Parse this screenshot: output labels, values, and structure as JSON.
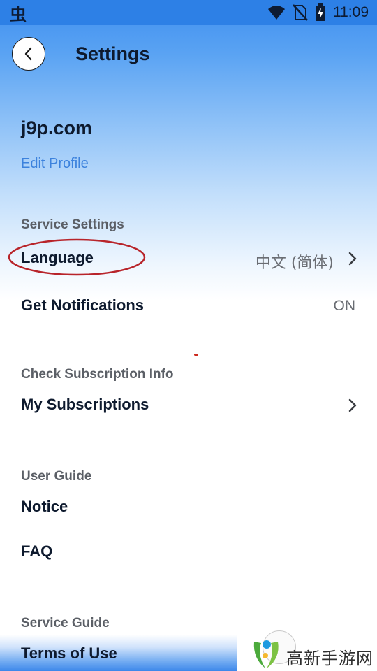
{
  "status_bar": {
    "left_glyph": "虫",
    "time": "11:09",
    "icons": [
      "wifi-icon",
      "no-sim-icon",
      "battery-charging-icon"
    ]
  },
  "header": {
    "back_icon": "chevron-left-icon",
    "title": "Settings"
  },
  "profile": {
    "name": "j9p.com",
    "edit_label": "Edit Profile"
  },
  "sections": {
    "service_settings": {
      "header": "Service Settings",
      "language": {
        "label": "Language",
        "value": "中文 (简体)"
      },
      "notifications": {
        "label": "Get Notifications",
        "value": "ON"
      }
    },
    "subscription": {
      "header": "Check Subscription Info",
      "my_subscriptions": {
        "label": "My Subscriptions"
      }
    },
    "user_guide": {
      "header": "User Guide",
      "notice": {
        "label": "Notice"
      },
      "faq": {
        "label": "FAQ"
      }
    },
    "service_guide": {
      "header": "Service Guide",
      "terms": {
        "label": "Terms of Use"
      }
    }
  },
  "watermark": {
    "text": "高新手游网"
  },
  "colors": {
    "accent": "#3c82dd",
    "status_bar": "#2d80e6",
    "annotation": "#b8242a"
  }
}
